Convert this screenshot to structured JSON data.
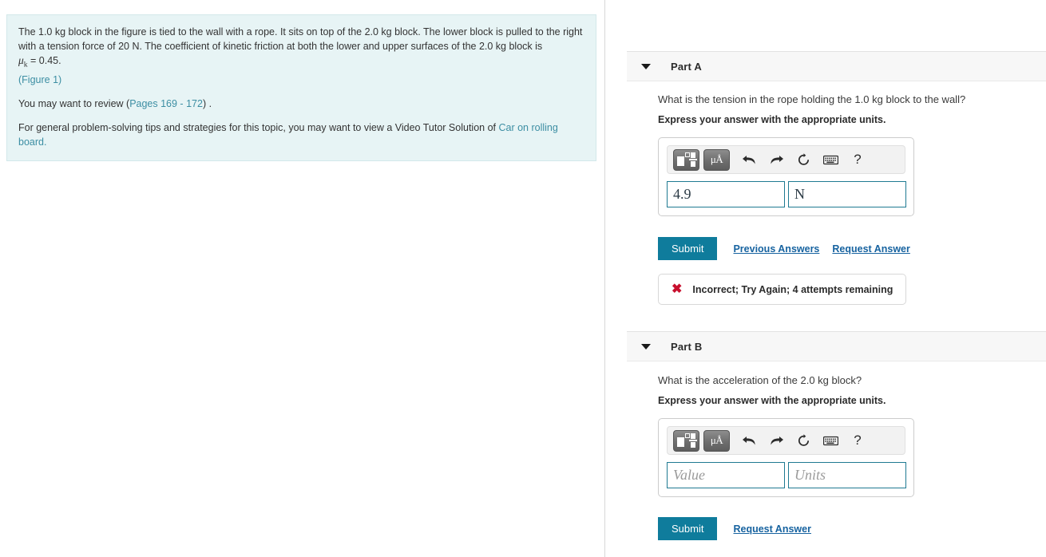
{
  "problem": {
    "paragraph1_before_mu": "The 1.0 kg block in the figure is tied to the wall with a rope. It sits on top of the 2.0 kg block. The lower block is pulled to the right with a tension force of 20 N. The coefficient of kinetic friction at both the lower and upper surfaces of the 2.0 kg block is",
    "mu_symbol": "μ",
    "mu_subscript": "k",
    "mu_value": " = 0.45.",
    "figure_link": "(Figure 1)",
    "review_prefix": "You may want to review (",
    "review_link": "Pages 169 - 172",
    "review_suffix": ") .",
    "tips_prefix": "For general problem-solving tips and strategies for this topic, you may want to view a Video Tutor Solution of ",
    "tips_link": "Car on rolling board",
    "tips_suffix": "."
  },
  "toolbar": {
    "template_icon": "template-matrix-icon",
    "units_label": "μÅ",
    "undo_icon": "⤷",
    "redo_icon": "⤶",
    "reset_icon": "↺",
    "keyboard_icon": "keyboard-icon",
    "help_icon": "?"
  },
  "parts": [
    {
      "id": "a",
      "label": "Part A",
      "question": "What is the tension in the rope holding the 1.0 kg block to the wall?",
      "instruction": "Express your answer with the appropriate units.",
      "value_field": "4.9",
      "value_placeholder": "Value",
      "units_field": "N",
      "units_placeholder": "Units",
      "submit_label": "Submit",
      "previous_answers_label": "Previous Answers",
      "request_answer_label": "Request Answer",
      "feedback": {
        "icon": "✖",
        "text": "Incorrect; Try Again; 4 attempts remaining"
      }
    },
    {
      "id": "b",
      "label": "Part B",
      "question": "What is the acceleration of the 2.0 kg block?",
      "instruction": "Express your answer with the appropriate units.",
      "value_field": "",
      "value_placeholder": "Value",
      "units_field": "",
      "units_placeholder": "Units",
      "submit_label": "Submit",
      "request_answer_label": "Request Answer"
    }
  ],
  "colors": {
    "problem_background": "#e7f4f5",
    "link": "#3c8ea3",
    "submit_button": "#0f7c9c",
    "field_border": "#1f7a92",
    "error": "#c8102e",
    "part_header_background": "#f7f7f7"
  }
}
